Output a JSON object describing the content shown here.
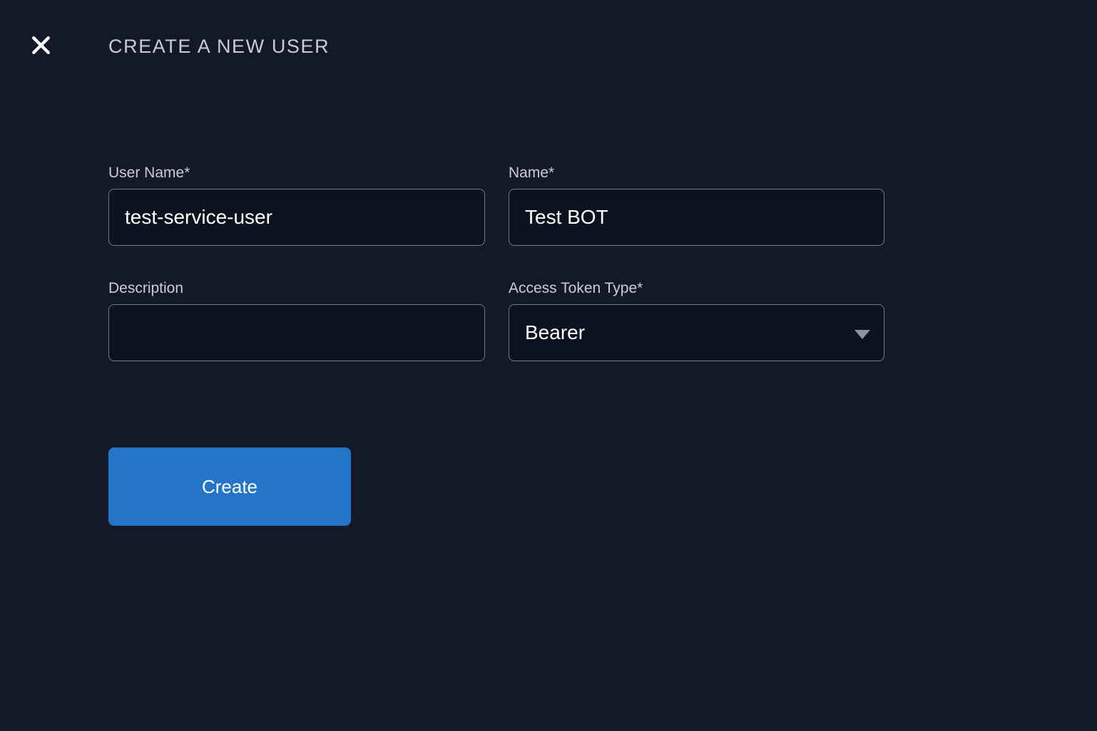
{
  "colors": {
    "background": "#131928",
    "field_background": "#0d1220",
    "field_border": "#747a84",
    "label_text": "#c9cdd4",
    "title_text": "#c8cdd5",
    "input_text": "#ffffff",
    "accent_button": "#2475c8",
    "caret_gray": "#8e939c"
  },
  "header": {
    "title": "CREATE A NEW USER",
    "close_icon": "x-icon"
  },
  "form": {
    "required_marker": "*",
    "fields": [
      {
        "label": "User Name",
        "required": true,
        "type": "text",
        "value": "test-service-user",
        "placeholder": ""
      },
      {
        "label": "Name",
        "required": true,
        "type": "text",
        "value": "Test BOT",
        "placeholder": ""
      },
      {
        "label": "Description",
        "required": false,
        "type": "textarea",
        "value": "",
        "placeholder": ""
      },
      {
        "label": "Access Token Type",
        "required": true,
        "type": "select",
        "value": "Bearer",
        "caret_icon": "chevron-down-icon"
      }
    ],
    "submit_label": "Create"
  }
}
